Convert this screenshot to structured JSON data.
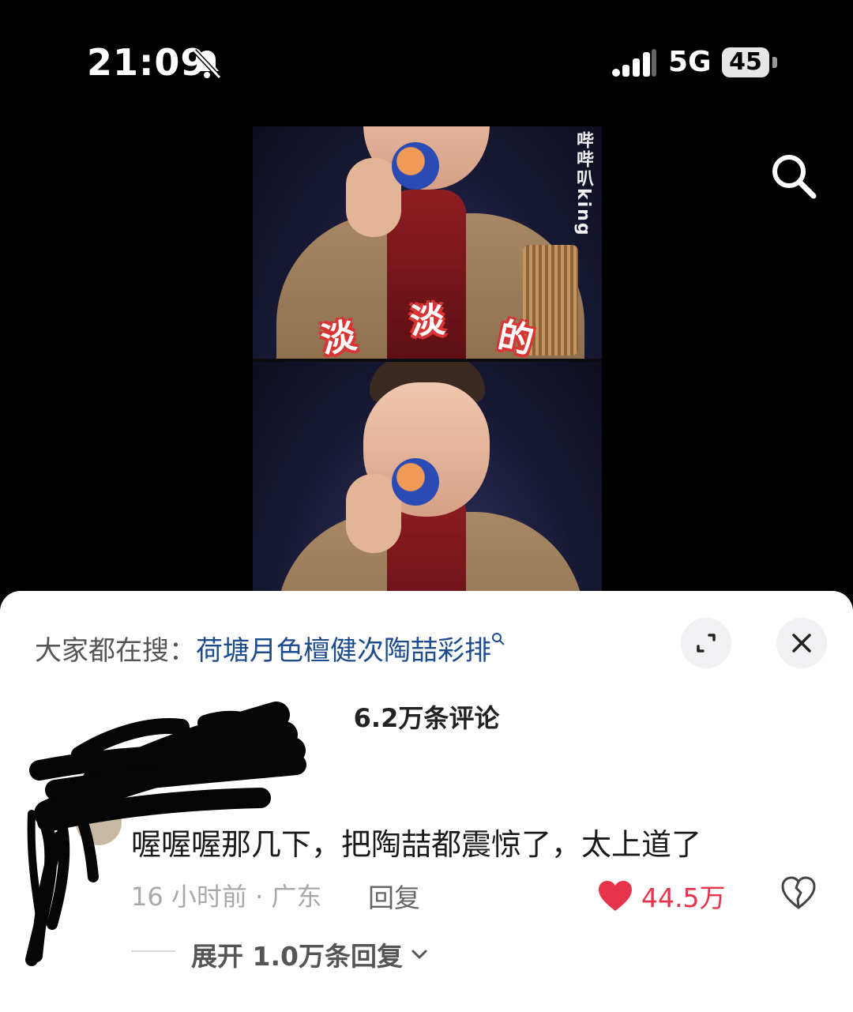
{
  "status_bar": {
    "time": "21:09",
    "network": "5G",
    "battery": "45",
    "icons": [
      "bell-muted-icon",
      "signal-icon",
      "battery-icon"
    ]
  },
  "video": {
    "watermark": "哔哔叭king",
    "caption_chars": [
      "淡",
      "淡",
      "的"
    ]
  },
  "top_actions": {
    "search_icon": "search-icon"
  },
  "trending": {
    "label": "大家都在搜：",
    "query": "荷塘月色檀健次陶喆彩排",
    "icon": "search-small-icon"
  },
  "sheet_buttons": {
    "expand_icon": "expand-icon",
    "close_icon": "close-icon"
  },
  "comments": {
    "count_label": "6.2万条评论",
    "items": [
      {
        "username": "",
        "text": "喔喔喔那几下，把陶喆都震惊了，太上道了",
        "time_location": "16 小时前 · 广东",
        "reply_label": "回复",
        "likes": "44.5万",
        "expand_label": "展开 1.0万条回复"
      }
    ]
  },
  "colors": {
    "like": "#e8344a",
    "link": "#1d4b8e",
    "sheet_bg": "#ffffff",
    "screen_bg": "#000000"
  }
}
